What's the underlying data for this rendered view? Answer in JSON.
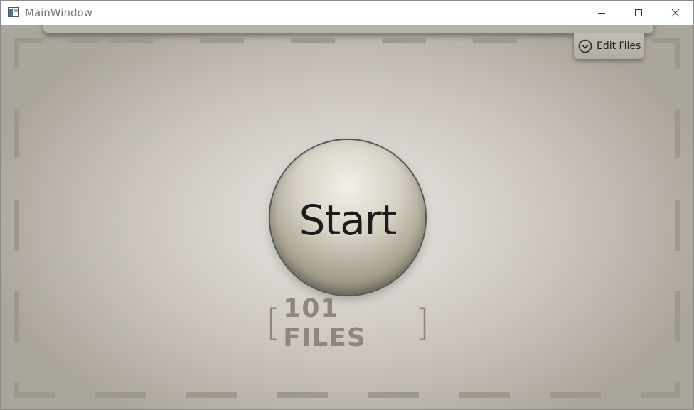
{
  "window": {
    "title": "MainWindow"
  },
  "toolbar": {
    "edit_files_label": "Edit Files",
    "edit_files_icon": "chevron-down-circle-icon"
  },
  "main": {
    "start_label": "Start",
    "files_count_text": "101 FILES",
    "bracket_open": "[",
    "bracket_close": "]"
  },
  "colors": {
    "background_center": "#e8e4df",
    "background_edge": "#aba69c",
    "files_count_text": "#8d877d",
    "start_ring": "#4f5a55"
  }
}
